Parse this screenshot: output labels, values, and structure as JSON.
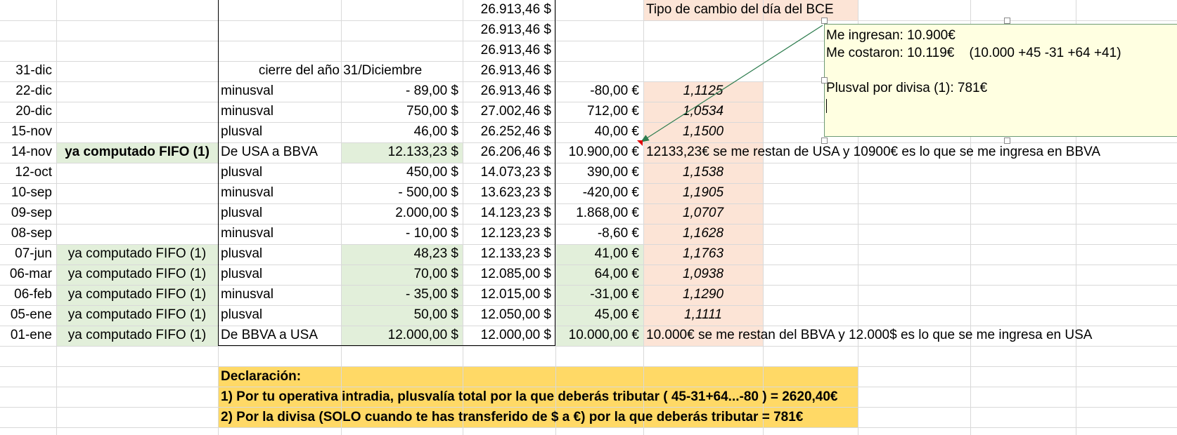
{
  "header_note": "Tipo de cambio del día del BCE",
  "top_balances": [
    "26.913,46 $",
    "26.913,46 $",
    "26.913,46 $"
  ],
  "year_close": {
    "date": "31-dic",
    "label": "cierre del año 31/Diciembre",
    "balance": "26.913,46 $"
  },
  "rows": [
    {
      "date": "22-dic",
      "fifo": "",
      "concept": "minusval",
      "usd": "- 89,00 $",
      "balance": "26.913,46 $",
      "eur": "-80,00 €",
      "rate": "1,1125",
      "note": ""
    },
    {
      "date": "20-dic",
      "fifo": "",
      "concept": "minusval",
      "usd": "750,00 $",
      "balance": "27.002,46 $",
      "eur": "712,00 €",
      "rate": "1,0534",
      "note": ""
    },
    {
      "date": "15-nov",
      "fifo": "",
      "concept": "plusval",
      "usd": "46,00 $",
      "balance": "26.252,46 $",
      "eur": "40,00 €",
      "rate": "1,1500",
      "note": ""
    },
    {
      "date": "14-nov",
      "fifo": "ya computado FIFO (1)",
      "concept": "De USA a BBVA",
      "usd": "12.133,23 $",
      "balance": "26.206,46 $",
      "eur": "10.900,00 €",
      "rate": "",
      "note": "12133,23€ se me restan de USA y 10900€ es lo que se me ingresa en BBVA"
    },
    {
      "date": "12-oct",
      "fifo": "",
      "concept": "plusval",
      "usd": "450,00 $",
      "balance": "14.073,23 $",
      "eur": "390,00 €",
      "rate": "1,1538",
      "note": ""
    },
    {
      "date": "10-sep",
      "fifo": "",
      "concept": "minusval",
      "usd": "- 500,00 $",
      "balance": "13.623,23 $",
      "eur": "-420,00 €",
      "rate": "1,1905",
      "note": ""
    },
    {
      "date": "09-sep",
      "fifo": "",
      "concept": "plusval",
      "usd": "2.000,00 $",
      "balance": "14.123,23 $",
      "eur": "1.868,00 €",
      "rate": "1,0707",
      "note": ""
    },
    {
      "date": "08-sep",
      "fifo": "",
      "concept": "minusval",
      "usd": "- 10,00 $",
      "balance": "12.123,23 $",
      "eur": "-8,60 €",
      "rate": "1,1628",
      "note": ""
    },
    {
      "date": "07-jun",
      "fifo": "ya computado FIFO (1)",
      "concept": "plusval",
      "usd": "48,23 $",
      "balance": "12.133,23 $",
      "eur": "41,00 €",
      "rate": "1,1763",
      "note": ""
    },
    {
      "date": "06-mar",
      "fifo": "ya computado FIFO (1)",
      "concept": "plusval",
      "usd": "70,00 $",
      "balance": "12.085,00 $",
      "eur": "64,00 €",
      "rate": "1,0938",
      "note": ""
    },
    {
      "date": "06-feb",
      "fifo": "ya computado FIFO (1)",
      "concept": "minusval",
      "usd": "- 35,00 $",
      "balance": "12.015,00 $",
      "eur": "-31,00 €",
      "rate": "1,1290",
      "note": ""
    },
    {
      "date": "05-ene",
      "fifo": "ya computado FIFO (1)",
      "concept": "plusval",
      "usd": "50,00 $",
      "balance": "12.050,00 $",
      "eur": "45,00 €",
      "rate": "1,1111",
      "note": ""
    },
    {
      "date": "01-ene",
      "fifo": "ya computado FIFO (1)",
      "concept": "De BBVA a USA",
      "usd": "12.000,00 $",
      "balance": "12.000,00 $",
      "eur": "10.000,00 €",
      "rate": "",
      "note": "10.000€ se me restan del BBVA y 12.000$ es lo que se me ingresa en USA"
    }
  ],
  "comment": {
    "line1": "Me ingresan: 10.900€",
    "line2": "Me costaron: 10.119€    (10.000 +45 -31 +64 +41)",
    "line3": "",
    "line4": "Plusval por divisa (1): 781€"
  },
  "declaration": {
    "title": "Declaración:",
    "line1": "1) Por tu operativa intradia, plusvalía total por la que deberás tributar ( 45-31+64...-80 ) = 2620,40€",
    "line2": "2) Por la divisa (SOLO cuando te has transferido de $ a €) por la que deberás tributar = 781€"
  },
  "colors": {
    "green_fill": "#e2efda",
    "peach_fill": "#fce4d6",
    "orange_fill": "#ffd966",
    "comment_bg": "#ffffe1",
    "arrow": "#2e7d4f"
  }
}
